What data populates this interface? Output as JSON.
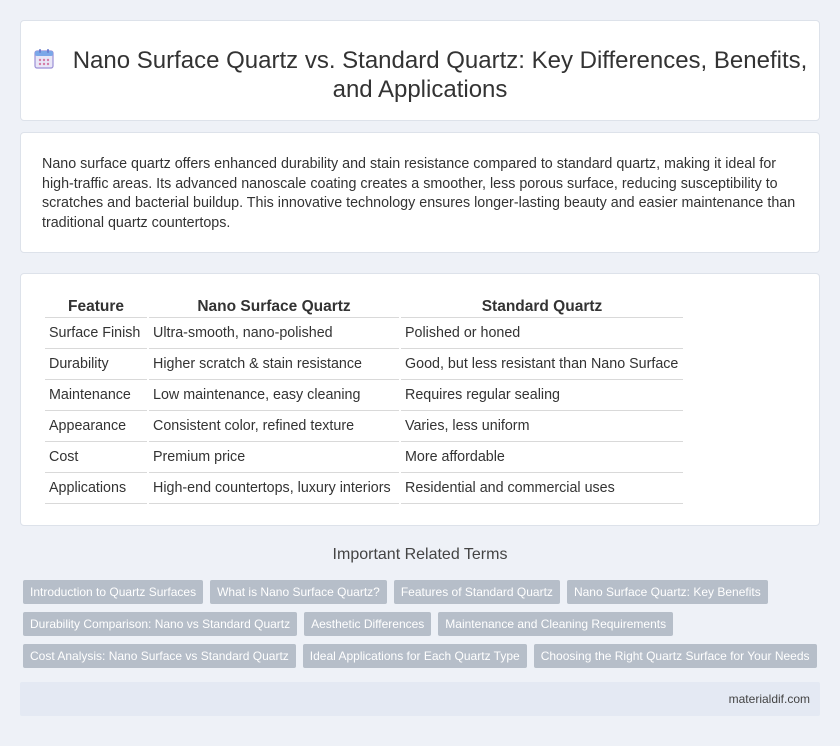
{
  "header": {
    "title": "Nano Surface Quartz vs. Standard Quartz: Key Differences, Benefits, and Applications",
    "icon": "calendar-icon"
  },
  "summary": {
    "text": "Nano surface quartz offers enhanced durability and stain resistance compared to standard quartz, making it ideal for high-traffic areas. Its advanced nanoscale coating creates a smoother, less porous surface, reducing susceptibility to scratches and bacterial buildup. This innovative technology ensures longer-lasting beauty and easier maintenance than traditional quartz countertops."
  },
  "table": {
    "headers": [
      "Feature",
      "Nano Surface Quartz",
      "Standard Quartz"
    ],
    "rows": [
      [
        "Surface Finish",
        "Ultra-smooth, nano-polished",
        "Polished or honed"
      ],
      [
        "Durability",
        "Higher scratch & stain resistance",
        "Good, but less resistant than Nano Surface"
      ],
      [
        "Maintenance",
        "Low maintenance, easy cleaning",
        "Requires regular sealing"
      ],
      [
        "Appearance",
        "Consistent color, refined texture",
        "Varies, less uniform"
      ],
      [
        "Cost",
        "Premium price",
        "More affordable"
      ],
      [
        "Applications",
        "High-end countertops, luxury interiors",
        "Residential and commercial uses"
      ]
    ]
  },
  "related": {
    "title": "Important Related Terms",
    "tags": [
      "Introduction to Quartz Surfaces",
      "What is Nano Surface Quartz?",
      "Features of Standard Quartz",
      "Nano Surface Quartz: Key Benefits",
      "Durability Comparison: Nano vs Standard Quartz",
      "Aesthetic Differences",
      "Maintenance and Cleaning Requirements",
      "Cost Analysis: Nano Surface vs Standard Quartz",
      "Ideal Applications for Each Quartz Type",
      "Choosing the Right Quartz Surface for Your Needs"
    ]
  },
  "footer": {
    "site": "materialdif.com"
  },
  "colors": {
    "page_bg": "#eef1f7",
    "tag_bg": "#b6bec9",
    "footer_bg": "#e4e9f3"
  }
}
